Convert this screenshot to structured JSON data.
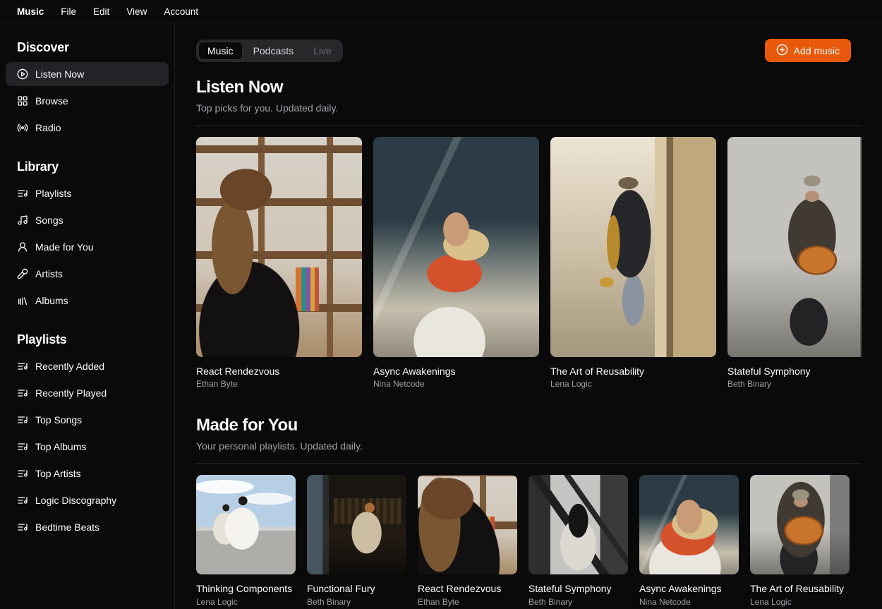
{
  "colors": {
    "accent_orange": "#e9590c",
    "background": "#0a0a0a"
  },
  "menubar": {
    "items": [
      "Music",
      "File",
      "Edit",
      "View",
      "Account"
    ]
  },
  "sidebar": {
    "sections": [
      {
        "title": "Discover",
        "items": [
          {
            "label": "Listen Now",
            "icon": "play-circle-icon",
            "active": true
          },
          {
            "label": "Browse",
            "icon": "layout-grid-icon",
            "active": false
          },
          {
            "label": "Radio",
            "icon": "radio-icon",
            "active": false
          }
        ]
      },
      {
        "title": "Library",
        "items": [
          {
            "label": "Playlists",
            "icon": "list-music-icon",
            "active": false
          },
          {
            "label": "Songs",
            "icon": "music-note-icon",
            "active": false
          },
          {
            "label": "Made for You",
            "icon": "user-icon",
            "active": false
          },
          {
            "label": "Artists",
            "icon": "mic-icon",
            "active": false
          },
          {
            "label": "Albums",
            "icon": "library-icon",
            "active": false
          }
        ]
      },
      {
        "title": "Playlists",
        "items": [
          {
            "label": "Recently Added",
            "icon": "list-music-icon",
            "active": false
          },
          {
            "label": "Recently Played",
            "icon": "list-music-icon",
            "active": false
          },
          {
            "label": "Top Songs",
            "icon": "list-music-icon",
            "active": false
          },
          {
            "label": "Top Albums",
            "icon": "list-music-icon",
            "active": false
          },
          {
            "label": "Top Artists",
            "icon": "list-music-icon",
            "active": false
          },
          {
            "label": "Logic Discography",
            "icon": "list-music-icon",
            "active": false
          },
          {
            "label": "Bedtime Beats",
            "icon": "list-music-icon",
            "active": false
          }
        ]
      }
    ]
  },
  "main": {
    "tabs": [
      {
        "label": "Music",
        "state": "active"
      },
      {
        "label": "Podcasts",
        "state": "default"
      },
      {
        "label": "Live",
        "state": "disabled"
      }
    ],
    "add_music_button": {
      "label": "Add music",
      "icon": "circle-plus-icon"
    },
    "sections": [
      {
        "title": "Listen Now",
        "subtitle": "Top picks for you. Updated daily.",
        "card_size": "large",
        "albums": [
          {
            "title": "React Rendezvous",
            "artist": "Ethan Byte",
            "art": "headphones-study"
          },
          {
            "title": "Async Awakenings",
            "artist": "Nina Netcode",
            "art": "window-portrait"
          },
          {
            "title": "The Art of Reusability",
            "artist": "Lena Logic",
            "art": "saxophone-street"
          },
          {
            "title": "Stateful Symphony",
            "artist": "Beth Binary",
            "art": "guitar-busker"
          }
        ]
      },
      {
        "title": "Made for You",
        "subtitle": "Your personal playlists. Updated daily.",
        "card_size": "small",
        "albums": [
          {
            "title": "Thinking Components",
            "artist": "Lena Logic",
            "art": "white-outfits"
          },
          {
            "title": "Functional Fury",
            "artist": "Beth Binary",
            "art": "piano-room"
          },
          {
            "title": "React Rendezvous",
            "artist": "Ethan Byte",
            "art": "headphones-study"
          },
          {
            "title": "Stateful Symphony",
            "artist": "Beth Binary",
            "art": "staircase-bw"
          },
          {
            "title": "Async Awakenings",
            "artist": "Nina Netcode",
            "art": "window-portrait"
          },
          {
            "title": "The Art of Reusability",
            "artist": "Lena Logic",
            "art": "guitar-busker"
          }
        ]
      }
    ]
  }
}
